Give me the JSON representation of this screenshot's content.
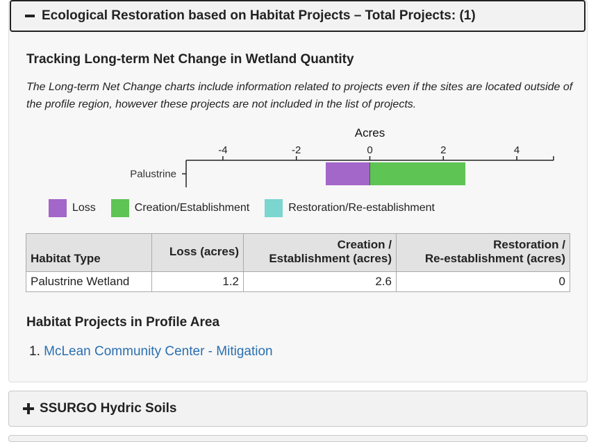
{
  "section_header": {
    "label": "Ecological Restoration based on Habitat Projects – Total Projects: (1)",
    "toggle_icon": "minus-icon"
  },
  "wetland_tracking": {
    "title": "Tracking Long-term Net Change in Wetland Quantity",
    "note": "The Long-term Net Change charts include information related to projects even if the sites are located outside of the profile region, however these projects are not included in the list of projects."
  },
  "chart_data": {
    "type": "bar",
    "orientation": "horizontal",
    "stacked": true,
    "title": "Acres",
    "categories": [
      "Palustrine"
    ],
    "xlim": [
      -5,
      5
    ],
    "xticks": [
      -4,
      -2,
      0,
      2,
      4
    ],
    "xtick_labels": [
      "-4",
      "-2",
      "0",
      "2",
      "4"
    ],
    "axis_position": "top",
    "series": [
      {
        "name": "Loss",
        "values": [
          -1.2
        ],
        "color": "#a366c9"
      },
      {
        "name": "Creation/Establishment",
        "values": [
          2.6
        ],
        "color": "#5ec454"
      },
      {
        "name": "Restoration/Re-establishment",
        "values": [
          0
        ],
        "color": "#7ad6cf"
      }
    ],
    "legend_position": "bottom-left",
    "grid": false
  },
  "table": {
    "headers": {
      "habitat_type": "Habitat Type",
      "loss": "Loss (acres)",
      "creation_line1": "Creation /",
      "creation_line2": "Establishment (acres)",
      "restoration_line1": "Restoration /",
      "restoration_line2": "Re-establishment (acres)"
    },
    "rows": [
      {
        "habitat_type": "Palustrine Wetland",
        "loss": "1.2",
        "creation": "2.6",
        "restoration": "0"
      }
    ]
  },
  "projects": {
    "title": "Habitat Projects in Profile Area",
    "items": [
      {
        "number": "1.",
        "label": "McLean Community Center - Mitigation"
      }
    ]
  },
  "collapsed_section": {
    "label": "SSURGO Hydric Soils",
    "toggle_icon": "plus-icon"
  }
}
